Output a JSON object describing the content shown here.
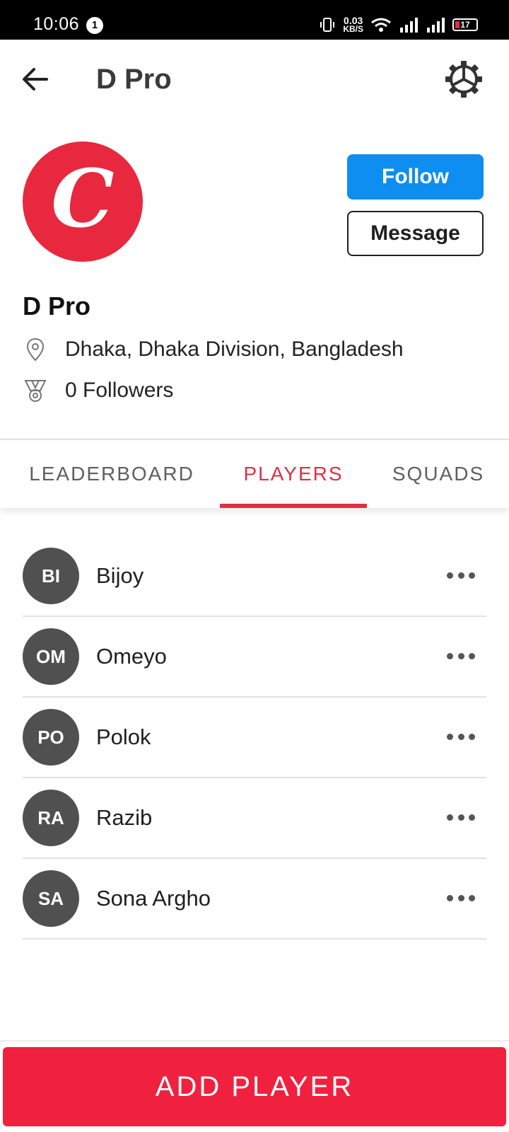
{
  "status_bar": {
    "time": "10:06",
    "notification_count": "1",
    "net_speed_value": "0.03",
    "net_speed_unit": "KB/S",
    "battery": "17"
  },
  "app_bar": {
    "title": "D Pro",
    "back_icon": "arrow-left-icon",
    "settings_icon": "gear-icon"
  },
  "profile": {
    "logo_letter": "C",
    "logo_color": "#e8283e",
    "name": "D Pro",
    "location": "Dhaka, Dhaka Division, Bangladesh",
    "followers": "0 Followers",
    "follow_label": "Follow",
    "message_label": "Message"
  },
  "tabs": [
    {
      "label": "LEADERBOARD",
      "active": false
    },
    {
      "label": "PLAYERS",
      "active": true
    },
    {
      "label": "SQUADS",
      "active": false
    }
  ],
  "players": [
    {
      "initials": "BI",
      "name": "Bijoy"
    },
    {
      "initials": "OM",
      "name": "Omeyo"
    },
    {
      "initials": "PO",
      "name": "Polok"
    },
    {
      "initials": "RA",
      "name": "Razib"
    },
    {
      "initials": "SA",
      "name": "Sona Argho"
    }
  ],
  "add_player_label": "ADD PLAYER",
  "colors": {
    "accent": "#e02f44",
    "follow": "#0d8ef0",
    "add_button": "#f0213f"
  }
}
